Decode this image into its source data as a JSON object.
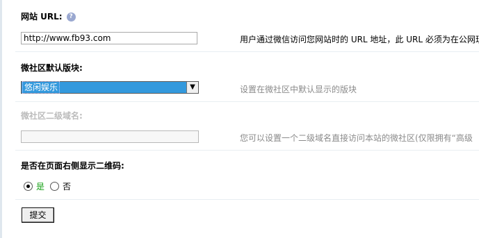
{
  "form": {
    "site_url": {
      "label": "网站 URL:",
      "value": "http://www.fb93.com",
      "description": "用户通过微信访问您网站时的 URL 地址，此 URL 必须为在公网现"
    },
    "default_forum": {
      "label": "微社区默认版块:",
      "selected": "悠闲娱乐",
      "description": "设置在微社区中默认显示的版块"
    },
    "subdomain": {
      "label": "微社区二级域名:",
      "value": "",
      "description": "您可以设置一个二级域名直接访问本站的微社区(仅限拥有“高级"
    },
    "show_qrcode": {
      "label": "是否在页面右侧显示二维码:",
      "options": [
        "是",
        "否"
      ],
      "selected": "是"
    },
    "submit_label": "提交"
  },
  "colors": {
    "select_bg": "#3399dd",
    "radio_yes": "#14a014",
    "disabled_label": "#bcbcbc"
  },
  "icons": {
    "help": "question-circle-icon"
  }
}
